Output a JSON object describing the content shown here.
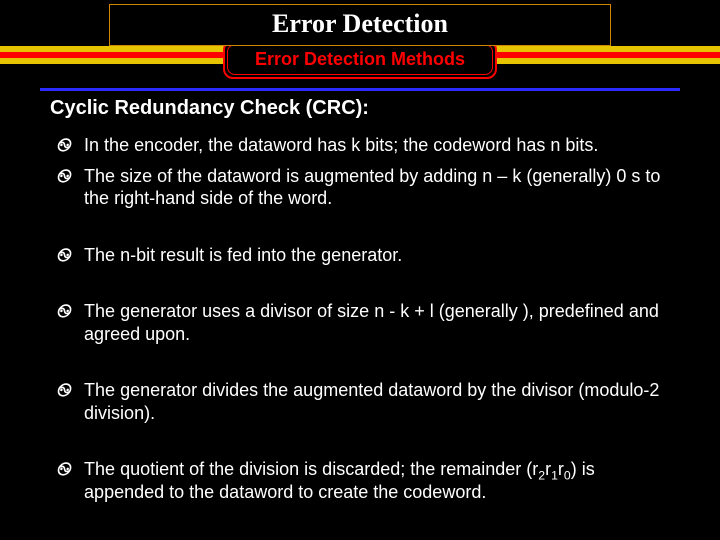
{
  "title": "Error Detection",
  "subtitle": "Error Detection Methods",
  "section": "Cyclic Redundancy Check (CRC):",
  "bullet_mark": "࿊",
  "bullets": [
    {
      "text": "In the encoder, the dataword has k bits; the codeword has n bits."
    },
    {
      "text": "The size of the dataword is augmented by adding n – k (generally) 0 s to the right-hand side of the word.",
      "gap_after": true
    },
    {
      "text": "The n-bit result is fed into the generator.",
      "gap_after": true
    },
    {
      "text": "The generator uses a divisor of size n - k + l (generally ), predefined and agreed upon.",
      "gap_after": true
    },
    {
      "text": "The generator divides the augmented dataword by the divisor (modulo-2 division).",
      "gap_after": true
    },
    {
      "html": "The quotient of the division is discarded; the remainder (r<sub>2</sub>r<sub>1</sub>r<sub>0</sub>) is appended to the dataword to create the codeword."
    }
  ]
}
